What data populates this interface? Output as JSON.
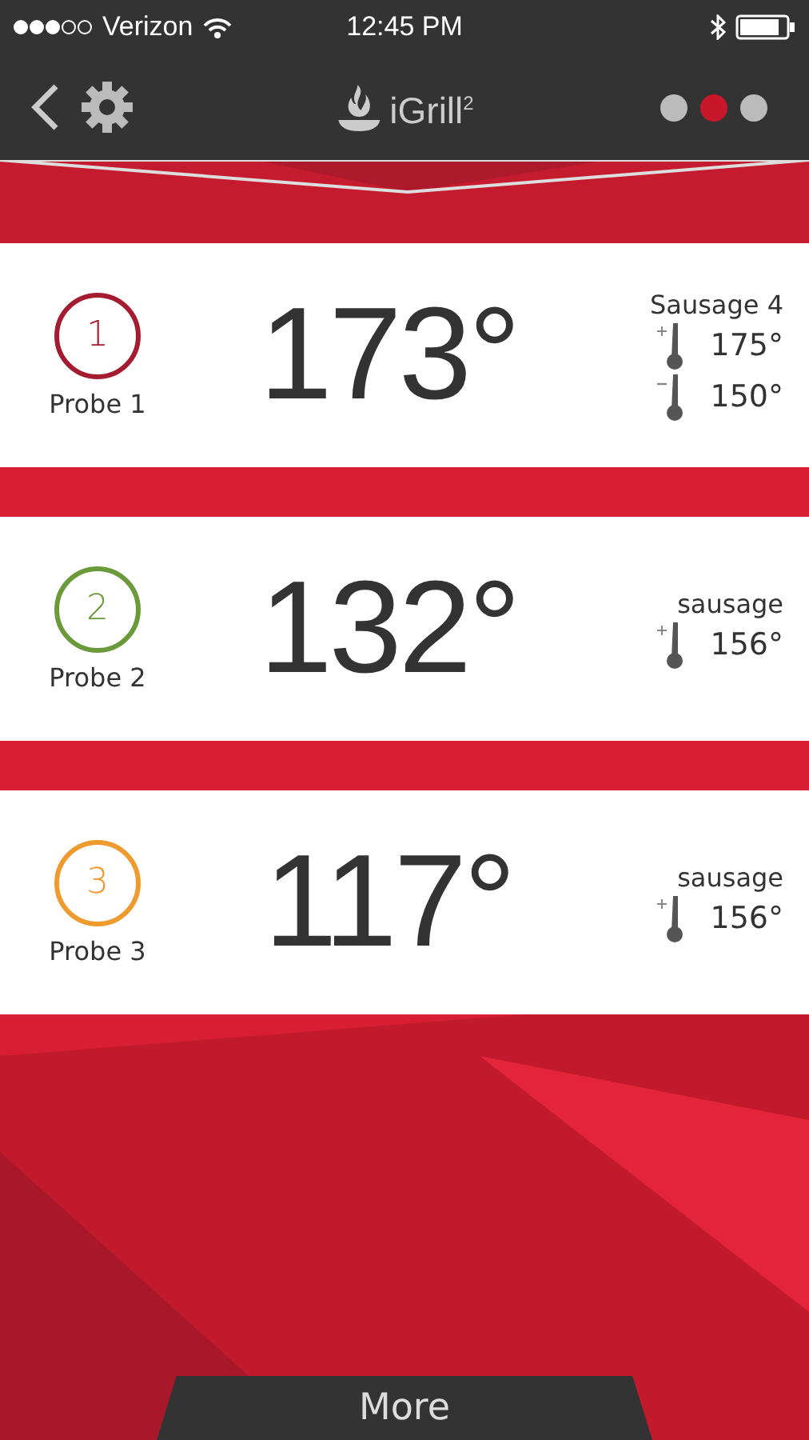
{
  "status_bar": {
    "carrier": "Verizon",
    "time": "12:45 PM"
  },
  "nav": {
    "logo_text": "iGrill",
    "logo_sup": "2",
    "pages": [
      {
        "selected": false
      },
      {
        "selected": true
      },
      {
        "selected": false
      }
    ]
  },
  "probes": [
    {
      "number": "1",
      "label": "Probe 1",
      "color": "#a51c30",
      "temperature": "173°",
      "preset": "Sausage 4",
      "targets": [
        {
          "kind": "high",
          "value": "175°"
        },
        {
          "kind": "low",
          "value": "150°"
        }
      ]
    },
    {
      "number": "2",
      "label": "Probe 2",
      "color": "#6a9a3a",
      "temperature": "132°",
      "preset": "sausage",
      "targets": [
        {
          "kind": "high",
          "value": "156°"
        }
      ]
    },
    {
      "number": "3",
      "label": "Probe 3",
      "color": "#ee9a2e",
      "temperature": "117°",
      "preset": "sausage",
      "targets": [
        {
          "kind": "high",
          "value": "156°"
        }
      ]
    }
  ],
  "more_button": "More"
}
